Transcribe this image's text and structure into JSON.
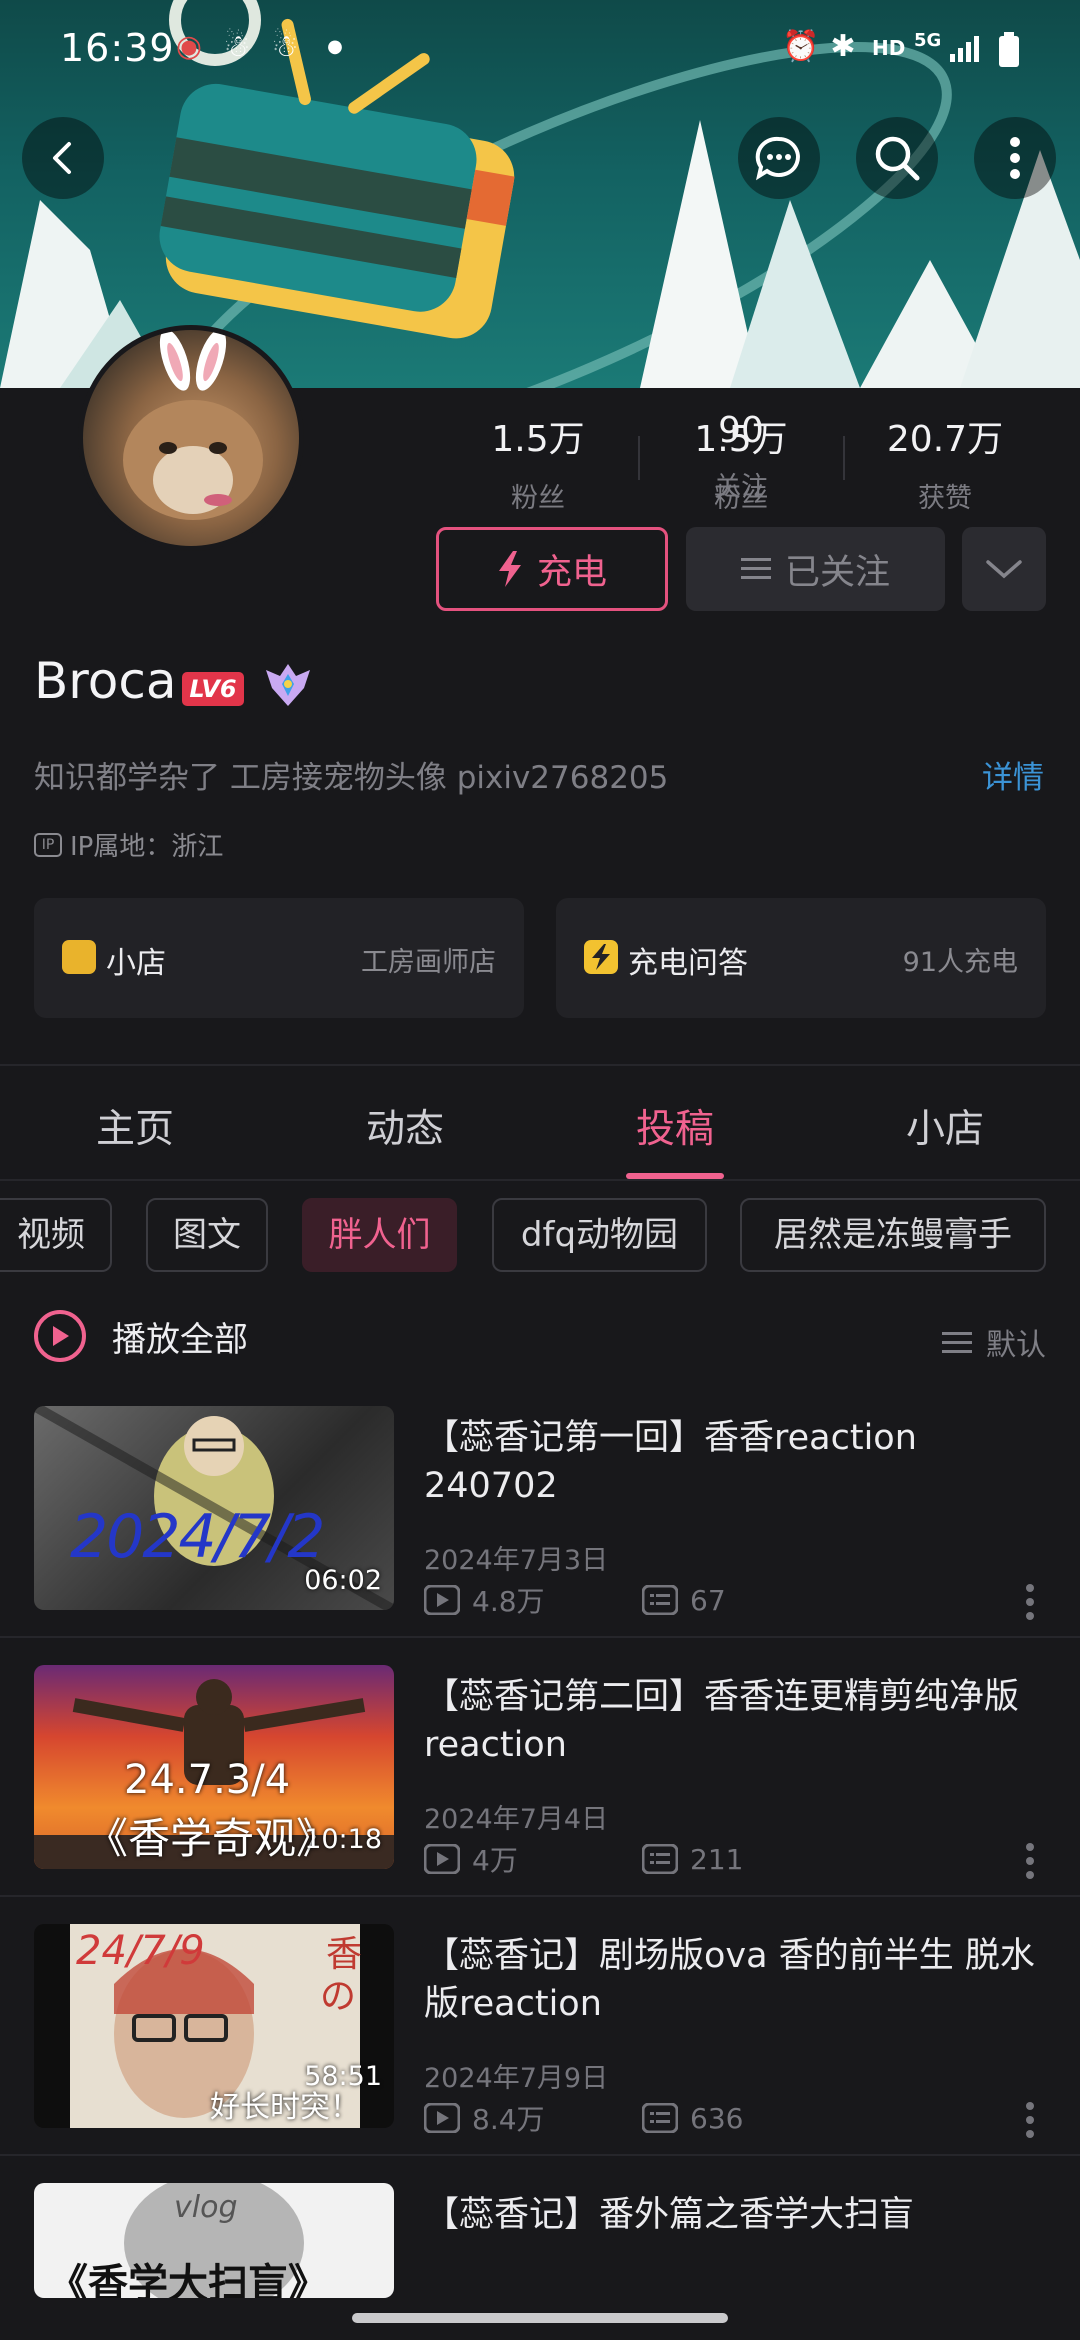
{
  "status_bar": {
    "time": "16:39",
    "network": "HD",
    "signal": "5G"
  },
  "profile": {
    "stats": [
      {
        "value": "1.5万",
        "label": "粉丝"
      },
      {
        "value": "90",
        "label": "关注"
      },
      {
        "value": "20.7万",
        "label": "获赞"
      }
    ],
    "charge_label": "充电",
    "follow_label": "已关注",
    "name": "Broca",
    "level": "LV6",
    "bio": "知识都学杂了 工房接宠物头像 pixiv2768205",
    "detail_label": "详情",
    "ip_label": "IP属地：浙江",
    "ip_icon": "IP"
  },
  "cards": [
    {
      "title": "小店",
      "value": "工房画师店",
      "icon_color": "#e9b32c"
    },
    {
      "title": "充电问答",
      "value": "91人充电",
      "icon_color": "#f2c230"
    }
  ],
  "tabs": [
    "主页",
    "动态",
    "投稿",
    "小店"
  ],
  "active_tab": "投稿",
  "chips": [
    "视频",
    "图文",
    "胖人们",
    "dfq动物园",
    "居然是冻鳗膏手"
  ],
  "play_all_label": "播放全部",
  "sort_label": "默认",
  "videos": [
    {
      "title": "【蕊香记第一回】香香reaction 240702",
      "duration": "06:02",
      "date": "2024年7月3日",
      "views": "4.8万",
      "comments": "67",
      "overlay": "2024/7/2"
    },
    {
      "title": "【蕊香记第二回】香香连更精剪纯净版reaction",
      "duration": "10:18",
      "date": "2024年7月4日",
      "views": "4万",
      "comments": "211",
      "overlay": "24.7.3/4",
      "overlay2": "《香学奇观》"
    },
    {
      "title": "【蕊香记】剧场版ova 香的前半生 脱水版reaction",
      "duration": "58:51",
      "date": "2024年7月9日",
      "views": "8.4万",
      "comments": "636",
      "overlay": "24/7/9",
      "overlay2": "好长时突！"
    },
    {
      "title": "【蕊香记】番外篇之香学大扫盲",
      "overlay": "《香学大扫盲》"
    }
  ],
  "accent_color": "#f0628f"
}
